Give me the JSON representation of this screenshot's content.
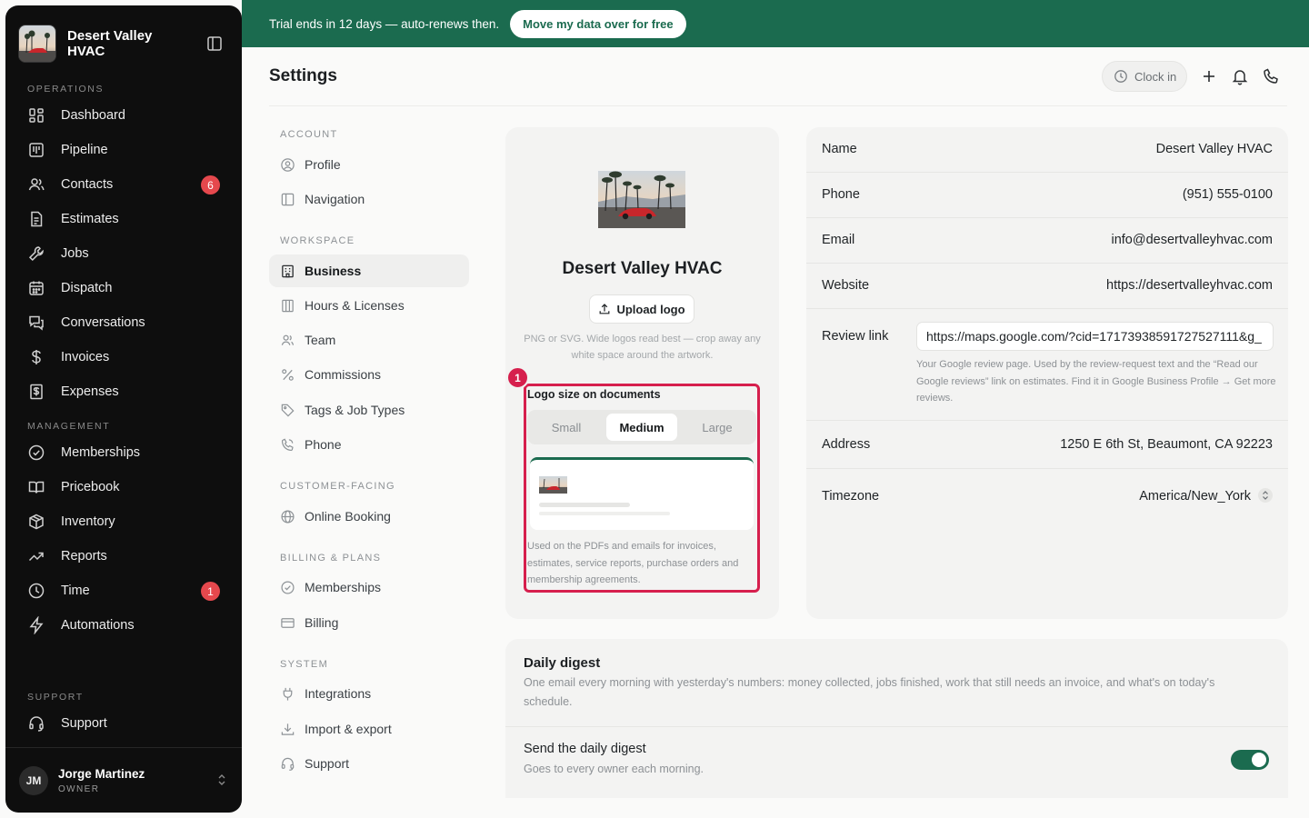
{
  "brand": {
    "name": "Desert Valley HVAC"
  },
  "banner": {
    "text": "Trial ends in 12 days — auto-renews then.",
    "cta": "Move my data over for free"
  },
  "sidebar": {
    "sections": {
      "operations": "OPERATIONS",
      "management": "MANAGEMENT",
      "support": "SUPPORT"
    },
    "items": [
      {
        "label": "Dashboard",
        "icon": "dashboard-icon"
      },
      {
        "label": "Pipeline",
        "icon": "pipeline-icon"
      },
      {
        "label": "Contacts",
        "icon": "contacts-icon",
        "badge": "6"
      },
      {
        "label": "Estimates",
        "icon": "estimates-icon"
      },
      {
        "label": "Jobs",
        "icon": "wrench-icon"
      },
      {
        "label": "Dispatch",
        "icon": "calendar-icon"
      },
      {
        "label": "Conversations",
        "icon": "chat-icon"
      },
      {
        "label": "Invoices",
        "icon": "dollar-icon"
      },
      {
        "label": "Expenses",
        "icon": "receipt-icon"
      },
      {
        "label": "Memberships",
        "icon": "check-circle-icon"
      },
      {
        "label": "Pricebook",
        "icon": "book-icon"
      },
      {
        "label": "Inventory",
        "icon": "box-icon"
      },
      {
        "label": "Reports",
        "icon": "trend-icon"
      },
      {
        "label": "Time",
        "icon": "clock-icon",
        "badge": "1"
      },
      {
        "label": "Automations",
        "icon": "bolt-icon"
      },
      {
        "label": "Support",
        "icon": "headset-icon"
      }
    ],
    "user": {
      "initials": "JM",
      "name": "Jorge Martinez",
      "role": "OWNER"
    }
  },
  "header": {
    "title": "Settings",
    "clock_in": "Clock in"
  },
  "settings_nav": {
    "sections": {
      "account": "ACCOUNT",
      "workspace": "WORKSPACE",
      "customer": "CUSTOMER-FACING",
      "billing": "BILLING & PLANS",
      "system": "SYSTEM"
    },
    "items": [
      {
        "label": "Profile"
      },
      {
        "label": "Navigation"
      },
      {
        "label": "Business"
      },
      {
        "label": "Hours & Licenses"
      },
      {
        "label": "Team"
      },
      {
        "label": "Commissions"
      },
      {
        "label": "Tags & Job Types"
      },
      {
        "label": "Phone"
      },
      {
        "label": "Online Booking"
      },
      {
        "label": "Memberships"
      },
      {
        "label": "Billing"
      },
      {
        "label": "Integrations"
      },
      {
        "label": "Import & export"
      },
      {
        "label": "Support"
      }
    ],
    "active": "Business"
  },
  "logo_card": {
    "business_name": "Desert Valley HVAC",
    "upload_label": "Upload logo",
    "hint": "PNG or SVG. Wide logos read best — crop away any white space around the artwork.",
    "highlight_number": "1",
    "logo_size_label": "Logo size on documents",
    "sizes": [
      "Small",
      "Medium",
      "Large"
    ],
    "selected_size": "Medium",
    "note": "Used on the PDFs and emails for invoices, estimates, service reports, purchase orders and membership agreements."
  },
  "info": {
    "name_label": "Name",
    "name": "Desert Valley HVAC",
    "phone_label": "Phone",
    "phone": "(951) 555-0100",
    "email_label": "Email",
    "email": "info@desertvalleyhvac.com",
    "website_label": "Website",
    "website": "https://desertvalleyhvac.com",
    "review_label": "Review link",
    "review_link": "https://maps.google.com/?cid=17173938591727527111&g_",
    "review_hint": "Your Google review page. Used by the review-request text and the “Read our Google reviews” link on estimates. Find it in Google Business Profile → Get more reviews.",
    "address_label": "Address",
    "address": "1250 E 6th St, Beaumont, CA 92223",
    "timezone_label": "Timezone",
    "timezone": "America/New_York"
  },
  "digest": {
    "title": "Daily digest",
    "description": "One email every morning with yesterday's numbers: money collected, jobs finished, work that still needs an invoice, and what's on today's schedule.",
    "send_label": "Send the daily digest",
    "send_sub": "Goes to every owner each morning.",
    "enabled": true
  },
  "colors": {
    "brand_green": "#1b6b4f",
    "badge_red": "#e5484d",
    "highlight": "#d61f4d",
    "sidebar_bg": "#0e0e0e"
  }
}
